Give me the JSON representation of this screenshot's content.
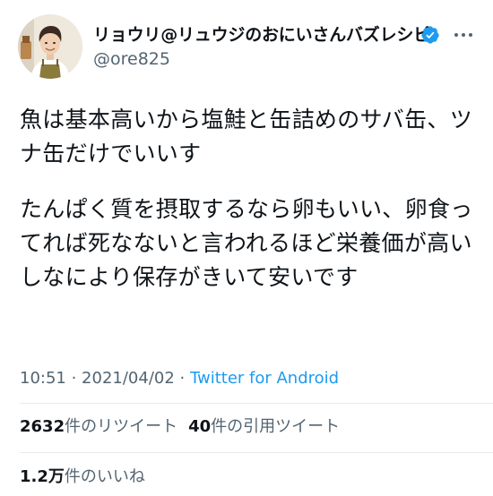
{
  "author": {
    "display_name": "リョウリ@リュウジのおにいさんバズレシピ",
    "handle": "@ore825",
    "verified_icon": "verified-badge-icon",
    "avatar_icon": "profile-avatar",
    "more_icon": "more-options-icon"
  },
  "tweet": {
    "paragraphs": [
      "魚は基本高いから塩鮭と缶詰めのサバ缶、ツナ缶だけでいいす",
      "たんぱく質を摂取するなら卵もいい、卵食ってれば死なないと言われるほど栄養価が高いしなにより保存がきいて安いです"
    ],
    "time": "10:51",
    "date": "2021/04/02",
    "separator": " · ",
    "source": "Twitter for Android"
  },
  "stats": {
    "retweets": {
      "count": "2632",
      "label": "件のリツイート"
    },
    "quotes": {
      "count": "40",
      "label": "件の引用ツイート"
    },
    "likes": {
      "count": "1.2万",
      "label": "件のいいね"
    }
  },
  "colors": {
    "text": "#0f1419",
    "muted": "#536471",
    "link": "#1d9bf0",
    "verified": "#1d9bf0",
    "divider": "#e7e9ec"
  }
}
